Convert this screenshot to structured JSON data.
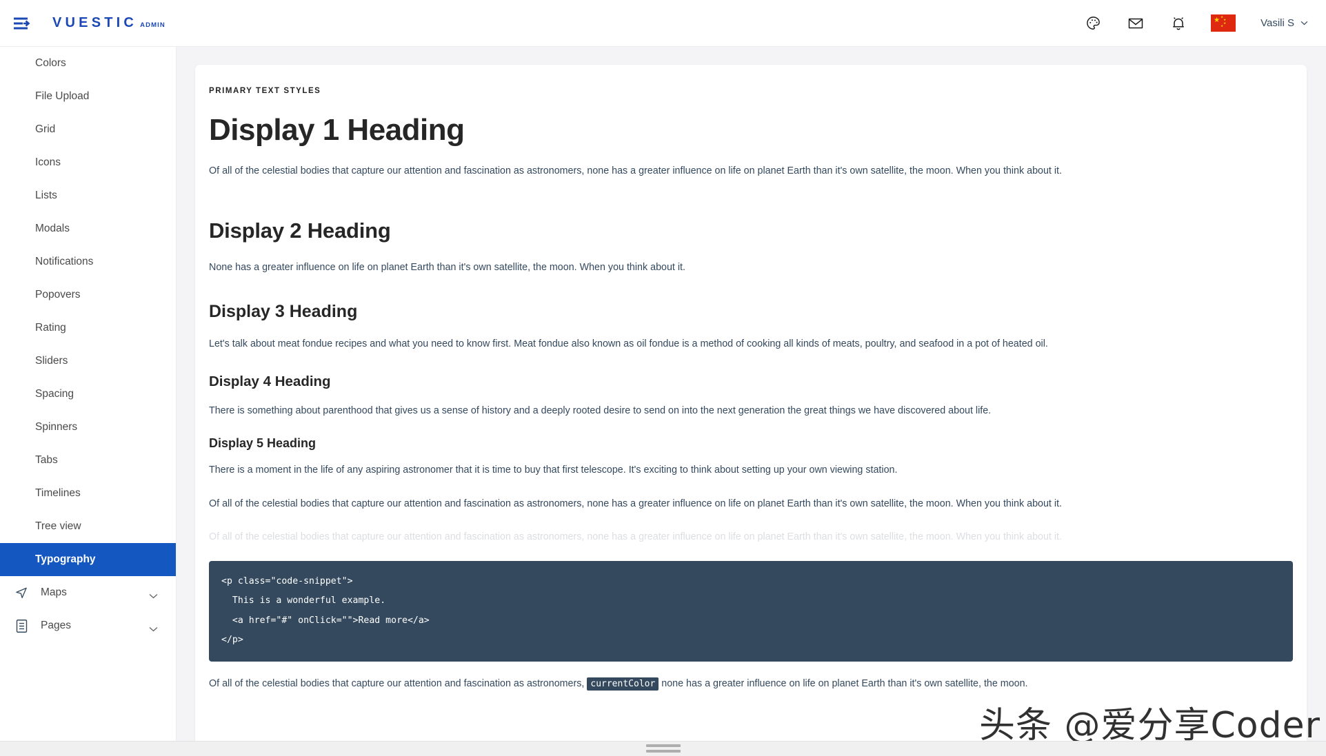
{
  "app": {
    "brand": "VUESTIC",
    "brand_suffix": "ADMIN",
    "accent_color": "#1557c0",
    "code_bg_color": "#34495e",
    "text_color": "#34495e"
  },
  "topbar": {
    "menu_toggle_icon": "hamburger-icon",
    "icons": [
      {
        "name": "palette-icon",
        "label": "Color theme"
      },
      {
        "name": "mail-icon",
        "label": "Messages"
      },
      {
        "name": "bell-icon",
        "label": "Notifications"
      }
    ],
    "language_flag": "China",
    "user_name": "Vasili S"
  },
  "sidebar": {
    "items": [
      {
        "label": "Colors",
        "active": false,
        "type": "link"
      },
      {
        "label": "File Upload",
        "active": false,
        "type": "link"
      },
      {
        "label": "Grid",
        "active": false,
        "type": "link"
      },
      {
        "label": "Icons",
        "active": false,
        "type": "link"
      },
      {
        "label": "Lists",
        "active": false,
        "type": "link"
      },
      {
        "label": "Modals",
        "active": false,
        "type": "link"
      },
      {
        "label": "Notifications",
        "active": false,
        "type": "link"
      },
      {
        "label": "Popovers",
        "active": false,
        "type": "link"
      },
      {
        "label": "Rating",
        "active": false,
        "type": "link"
      },
      {
        "label": "Sliders",
        "active": false,
        "type": "link"
      },
      {
        "label": "Spacing",
        "active": false,
        "type": "link"
      },
      {
        "label": "Spinners",
        "active": false,
        "type": "link"
      },
      {
        "label": "Tabs",
        "active": false,
        "type": "link"
      },
      {
        "label": "Timelines",
        "active": false,
        "type": "link"
      },
      {
        "label": "Tree view",
        "active": false,
        "type": "link"
      },
      {
        "label": "Typography",
        "active": true,
        "type": "link"
      }
    ],
    "groups": [
      {
        "label": "Maps",
        "icon": "navigation-arrow-icon",
        "expanded": false
      },
      {
        "label": "Pages",
        "icon": "document-list-icon",
        "expanded": false
      }
    ]
  },
  "content": {
    "eyebrow": "PRIMARY TEXT STYLES",
    "h1": "Display 1 Heading",
    "p1": "Of all of the celestial bodies that capture our attention and fascination as astronomers, none has a greater influence on life on planet Earth than it's own satellite, the moon. When you think about it.",
    "h2": "Display 2 Heading",
    "p2": "None has a greater influence on life on planet Earth than it's own satellite, the moon. When you think about it.",
    "h3": "Display 3 Heading",
    "p3": "Let's talk about meat fondue recipes and what you need to know first. Meat fondue also known as oil fondue is a method of cooking all kinds of meats, poultry, and seafood in a pot of heated oil.",
    "h4": "Display 4 Heading",
    "p4": "There is something about parenthood that gives us a sense of history and a deeply rooted desire to send on into the next generation the great things we have discovered about life.",
    "h5": "Display 5 Heading",
    "p5": "There is a moment in the life of any aspiring astronomer that it is time to buy that first telescope. It's exciting to think about setting up your own viewing station.",
    "p6": "Of all of the celestial bodies that capture our attention and fascination as astronomers, none has a greater influence on life on planet Earth than it's own satellite, the moon. When you think about it.",
    "p7_faded": "Of all of the celestial bodies that capture our attention and fascination as astronomers, none has a greater influence on life on planet Earth than it's own satellite, the moon. When you think about it.",
    "code_snippet": "<p class=\"code-snippet\">\n  This is a wonderful example.\n  <a href=\"#\" onClick=\"\">Read more</a>\n</p>",
    "p8_before": "Of all of the celestial bodies that capture our attention and fascination as astronomers, ",
    "p8_tag": "currentColor",
    "p8_after": " none has a greater influence on life on planet Earth than it's own satellite, the moon."
  },
  "watermark": {
    "text": "头条 @爱分享Coder"
  }
}
